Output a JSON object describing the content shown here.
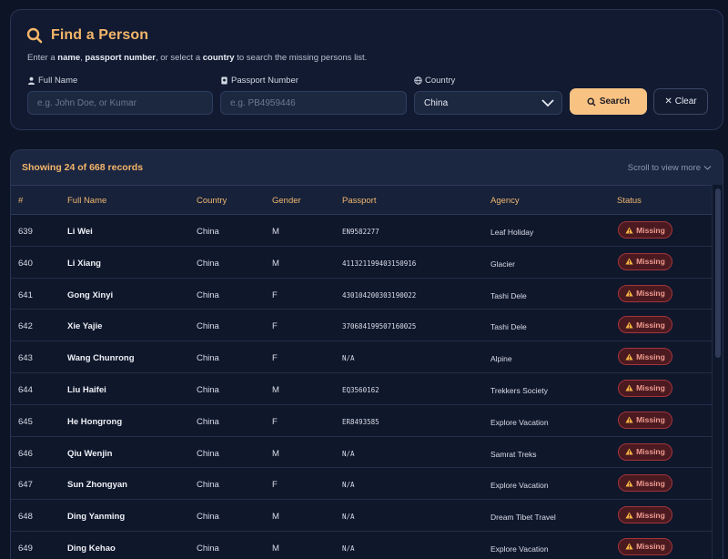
{
  "search": {
    "title": "Find a Person",
    "subtitle_parts": {
      "p1": "Enter a ",
      "b1": "name",
      "p2": ", ",
      "b2": "passport number",
      "p3": ", or select a ",
      "b3": "country",
      "p4": " to search the missing persons list."
    },
    "full_name_label": "Full Name",
    "full_name_placeholder": "e.g. John Doe, or Kumar",
    "full_name_value": "",
    "passport_label": "Passport Number",
    "passport_placeholder": "e.g. PB4959446",
    "passport_value": "",
    "country_label": "Country",
    "country_value": "China",
    "search_button": "Search",
    "clear_button": "Clear",
    "icons": [
      "search-icon",
      "user-icon",
      "passport-icon",
      "globe-icon",
      "chevron-down-icon",
      "close-icon"
    ]
  },
  "results": {
    "showing_text": "Showing 24 of 668 records",
    "scroll_hint": "Scroll to view more",
    "columns": [
      "#",
      "Full Name",
      "Country",
      "Gender",
      "Passport",
      "Agency",
      "Status"
    ],
    "rows": [
      {
        "id": "639",
        "name": "Li Wei",
        "country": "China",
        "gender": "M",
        "passport": "EN9582277",
        "agency": "Leaf Holiday",
        "status": "Missing"
      },
      {
        "id": "640",
        "name": "Li Xiang",
        "country": "China",
        "gender": "M",
        "passport": "411321199403150916",
        "agency": "Glacier",
        "status": "Missing"
      },
      {
        "id": "641",
        "name": "Gong Xinyi",
        "country": "China",
        "gender": "F",
        "passport": "430104200303190022",
        "agency": "Tashi Dele",
        "status": "Missing"
      },
      {
        "id": "642",
        "name": "Xie Yajie",
        "country": "China",
        "gender": "F",
        "passport": "370684199507160025",
        "agency": "Tashi Dele",
        "status": "Missing"
      },
      {
        "id": "643",
        "name": "Wang Chunrong",
        "country": "China",
        "gender": "F",
        "passport": "N/A",
        "agency": "Alpine",
        "status": "Missing"
      },
      {
        "id": "644",
        "name": "Liu Haifei",
        "country": "China",
        "gender": "M",
        "passport": "EQ3560162",
        "agency": "Trekkers Society",
        "status": "Missing"
      },
      {
        "id": "645",
        "name": "He Hongrong",
        "country": "China",
        "gender": "F",
        "passport": "ER8493585",
        "agency": "Explore Vacation",
        "status": "Missing"
      },
      {
        "id": "646",
        "name": "Qiu Wenjin",
        "country": "China",
        "gender": "M",
        "passport": "N/A",
        "agency": "Samrat Treks",
        "status": "Missing"
      },
      {
        "id": "647",
        "name": "Sun Zhongyan",
        "country": "China",
        "gender": "F",
        "passport": "N/A",
        "agency": "Explore Vacation",
        "status": "Missing"
      },
      {
        "id": "648",
        "name": "Ding Yanming",
        "country": "China",
        "gender": "M",
        "passport": "N/A",
        "agency": "Dream Tibet Travel",
        "status": "Missing"
      },
      {
        "id": "649",
        "name": "Ding Kehao",
        "country": "China",
        "gender": "M",
        "passport": "N/A",
        "agency": "Explore Vacation",
        "status": "Missing"
      }
    ]
  },
  "colors": {
    "background": "#0d1426",
    "accent": "#f5b66a",
    "button": "#f8c283",
    "missing_badge_bg": "#4a1a20",
    "missing_badge_text": "#f19a8e"
  }
}
